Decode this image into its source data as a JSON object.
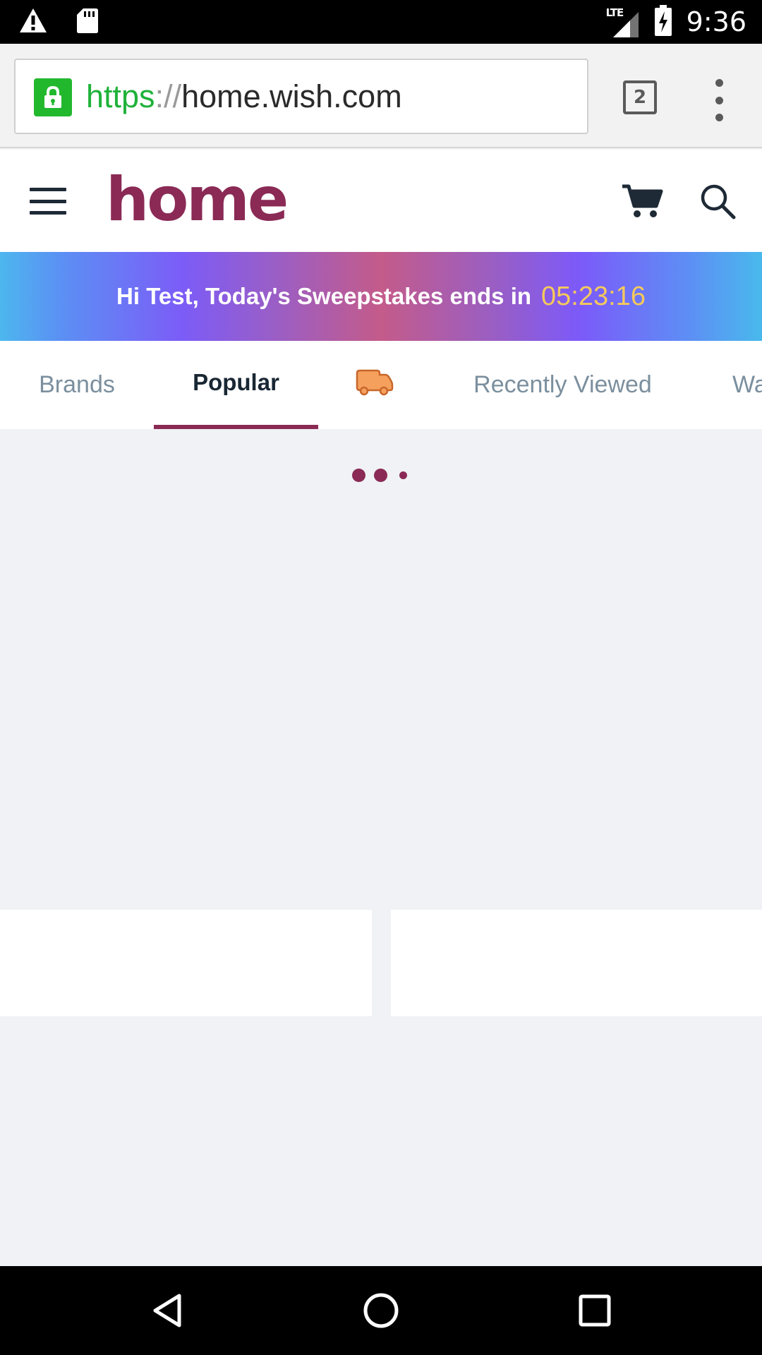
{
  "status_bar": {
    "time": "9:36",
    "network": "LTE",
    "icons": [
      "warning-icon",
      "sd-card-icon",
      "signal-icon",
      "battery-charging-icon"
    ]
  },
  "browser": {
    "url_scheme": "https",
    "url_separator": "://",
    "url_host": "home.wish.com",
    "tab_count": "2",
    "icons": [
      "lock-icon",
      "tabs-icon",
      "more-vert-icon"
    ]
  },
  "header": {
    "logo": "home",
    "icons": [
      "menu-icon",
      "cart-icon",
      "search-icon"
    ]
  },
  "banner": {
    "message": "Hi Test, Today's Sweepstakes ends in",
    "timer": "05:23:16"
  },
  "tabs": {
    "items": [
      {
        "label": "Brands"
      },
      {
        "label": "Popular"
      },
      {
        "label": "",
        "icon": "truck-icon"
      },
      {
        "label": "Recently Viewed"
      },
      {
        "label": "Wa"
      }
    ],
    "active": "Popular"
  },
  "content": {
    "state": "loading"
  },
  "colors": {
    "brand": "#8a2a55",
    "timer": "#f5c95c",
    "secure": "#22b82e",
    "background": "#f0f2f5"
  },
  "nav_bar": {
    "icons": [
      "back-icon",
      "home-icon",
      "recents-icon"
    ]
  }
}
